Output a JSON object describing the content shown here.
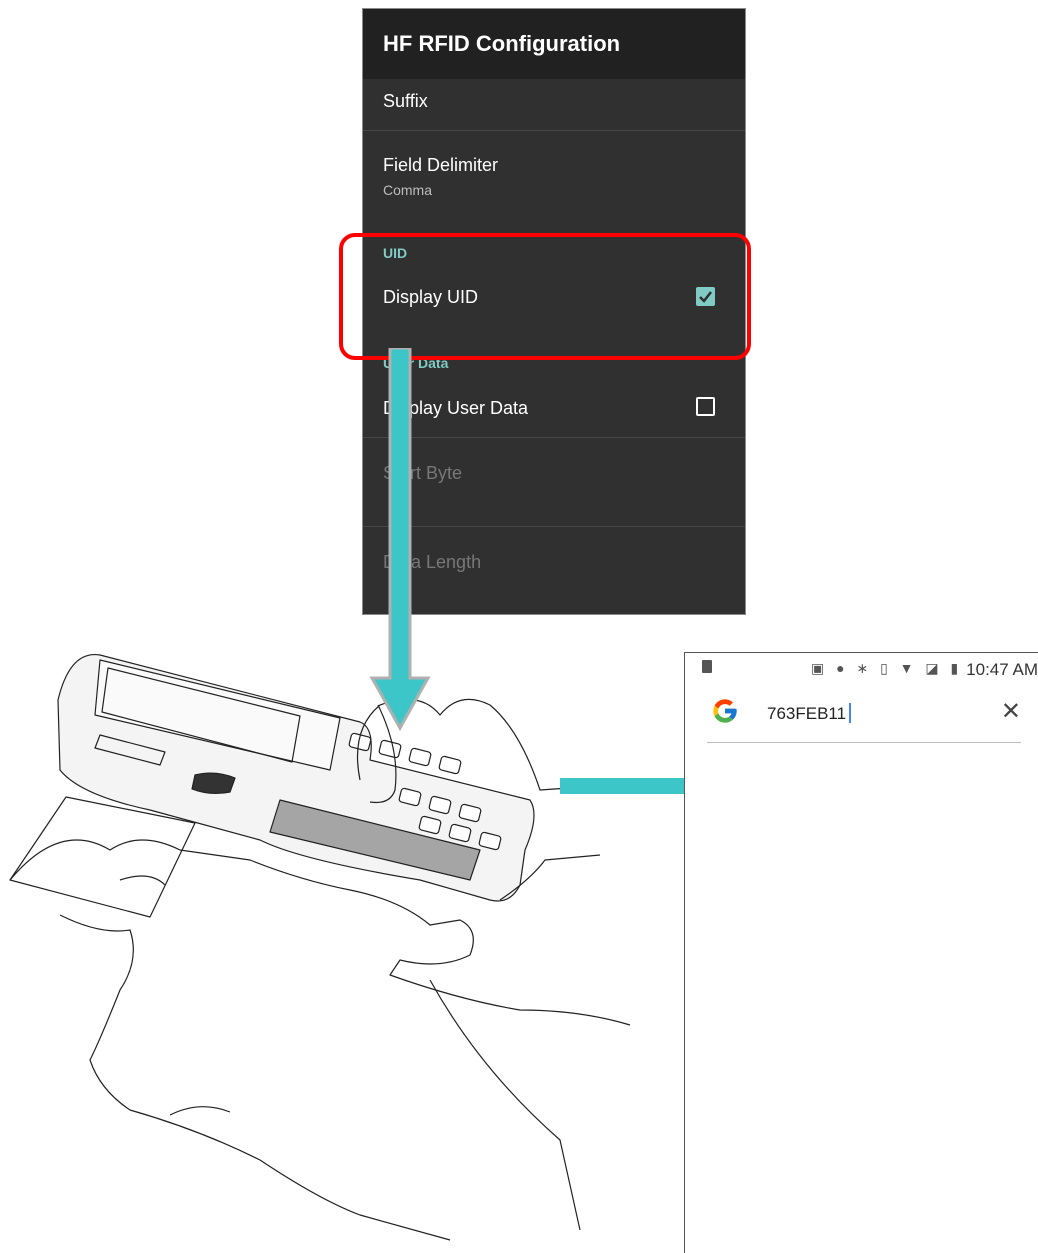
{
  "settings_screen": {
    "title": "HF RFID Configuration",
    "suffix_label": "Suffix",
    "field_delimiter": {
      "label": "Field Delimiter",
      "value": "Comma"
    },
    "uid_category": "UID",
    "display_uid": {
      "label": "Display UID",
      "checked": true
    },
    "user_data_category": "User Data",
    "display_user_data": {
      "label": "Display User Data",
      "checked": false
    },
    "start_byte_label": "Start Byte",
    "data_length_label": "Data Length"
  },
  "phone_screen": {
    "status_time": "10:47 AM",
    "status_icons": [
      "cast-icon",
      "location-icon",
      "bluetooth-icon",
      "vibrate-icon",
      "wifi-icon",
      "no-signal-icon",
      "battery-icon"
    ],
    "search_query": "763FEB11",
    "search_logo": "google-icon",
    "clear_icon": "close-icon"
  },
  "colors": {
    "accent": "#80cbc4",
    "highlight": "#ff0000",
    "arrow": "#3cc6c8",
    "settings_bg": "#303030"
  }
}
